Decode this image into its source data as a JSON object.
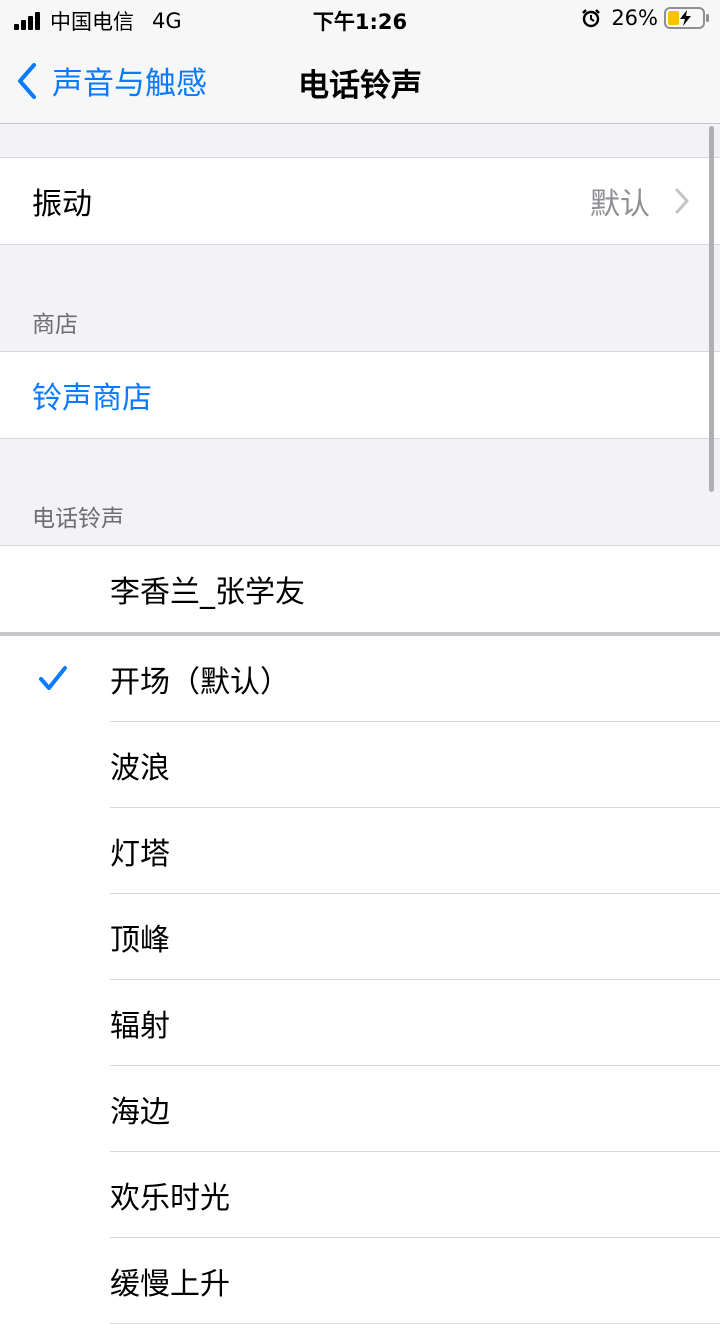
{
  "status_bar": {
    "carrier": "中国电信",
    "network": "4G",
    "time": "下午1:26",
    "battery": "26%"
  },
  "nav": {
    "back_label": "声音与触感",
    "title": "电话铃声"
  },
  "vibration": {
    "label": "振动",
    "value": "默认"
  },
  "store_section": {
    "header": "商店",
    "link": "铃声商店"
  },
  "ringtones": {
    "header": "电话铃声",
    "custom": "李香兰_张学友",
    "selected_index": 0,
    "items": [
      "开场（默认）",
      "波浪",
      "灯塔",
      "顶峰",
      "辐射",
      "海边",
      "欢乐时光",
      "缓慢上升"
    ]
  },
  "colors": {
    "accent": "#0a7aff",
    "background": "#f2f2f7"
  }
}
